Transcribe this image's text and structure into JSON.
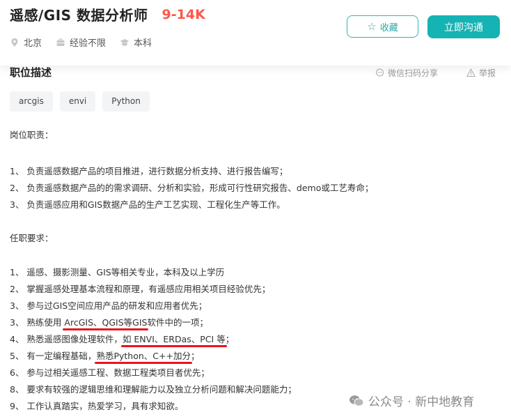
{
  "header": {
    "job_title": "遥感/GIS 数据分析师",
    "salary": "9-14K",
    "meta": {
      "location": "北京",
      "experience": "经验不限",
      "education": "本科"
    },
    "favorite_label": "收藏",
    "chat_label": "立即沟通"
  },
  "section": {
    "title": "职位描述",
    "share_label": "微信扫码分享",
    "report_label": "举报"
  },
  "tags": [
    "arcgis",
    "envi",
    "Python"
  ],
  "description": {
    "duties_title": "岗位职责：",
    "duties": [
      "1、 负责遥感数据产品的项目推进，进行数据分析支持、进行报告编写；",
      "2、 负责遥感数据产品的的需求调研、分析和实验，形成可行性研究报告、demo或工艺寿命；",
      "3、 负责遥感应用和GIS数据产品的生产工艺实现、工程化生产等工作。"
    ],
    "requirements_title": "任职要求：",
    "req1": "1、 遥感、摄影测量、GIS等相关专业，本科及以上学历",
    "req2": "2、 掌握遥感处理基本流程和原理，有遥感应用相关项目经验优先；",
    "req3": "3、 参与过GIS空间应用产品的研发和应用者优先；",
    "req4_pre": "3、 熟练使用 ",
    "req4_hl": "ArcGIS、QGIS等GIS",
    "req4_post": "软件中的一项；",
    "req5_pre": "4、 熟悉遥感图像处理软件，",
    "req5_hl": "如 ENVI、ERDas、PCI 等",
    "req5_post": "；",
    "req6_pre": "5、 有一定编程基础，",
    "req6_hl": "熟悉Python、C++加分",
    "req6_post": "；",
    "req7": "6、 参与过相关遥感工程、数据工程类项目者优先；",
    "req8": "8、 要求有较强的逻辑思维和理解能力以及独立分析问题和解决问题能力；",
    "req9": "9、 工作认真踏实，热爱学习，具有求知欲。"
  },
  "watermark": "公众号 · 新中地教育",
  "colors": {
    "accent": "#15b3b3",
    "salary": "#fe574a",
    "underline": "#e8141f"
  }
}
